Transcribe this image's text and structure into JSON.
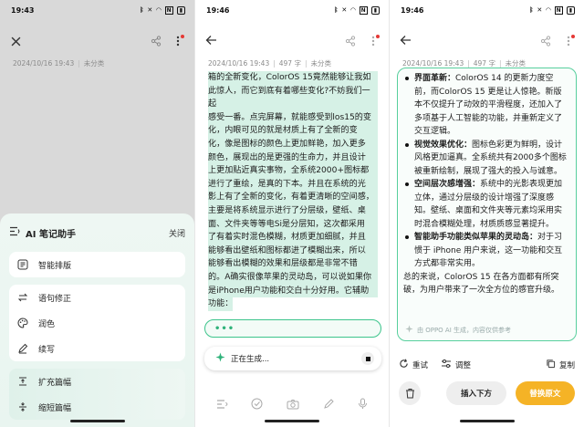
{
  "panel1": {
    "time": "19:43",
    "meta": {
      "date": "2024/10/16 19:43",
      "words": "",
      "category": "未分类"
    },
    "sheet": {
      "title": "AI 笔记助手",
      "close": "关闭",
      "items": [
        "智能排版",
        "语句修正",
        "润色",
        "续写",
        "扩充篇幅",
        "缩短篇幅"
      ]
    }
  },
  "panel2": {
    "time": "19:46",
    "meta": {
      "date": "2024/10/16 19:43",
      "words": "497 字",
      "category": "未分类"
    },
    "paragraph": [
      "箱的全新变化，ColorOS 15竟然能够让我如",
      "此惊人，而它到底有着哪些变化?不妨我们一起",
      "感受一番。点完屏幕，就能感受到los15的变",
      "化，内眼可见的就是材质上有了全新的变",
      "化，像是图标的颜色上更加鲜艳，加入更多",
      "颜色，展现出的是更强的生命力，并且设计",
      "上更加贴近真实事物，全系统2000+图标都",
      "进行了重绘，是真的下本。并且在系统的光",
      "影上有了全新的变化，有着更清晰的空间感，",
      "主要是将系统显示进行了分层级，壁纸、桌",
      "面、文件夹等等电Si是分层知，这次都采用",
      "了有着实时混色模糊，材质更加细腻，并且",
      "能够看出壁纸和图标都进了模糊出来，所以",
      "能够看出模糊的效果和层级都是非常不错",
      "的。A确实很像苹果的灵动岛，可以说如果你",
      "是iPhone用户功能和交白十分好用。它辅助",
      "功能："
    ],
    "generating": "正在生成..."
  },
  "panel3": {
    "time": "19:46",
    "meta": {
      "date": "2024/10/16 19:43",
      "words": "497 字",
      "category": "未分类"
    },
    "bullets": [
      {
        "head": "界面革新：",
        "lines": [
          "ColorOS 14 的更新力度空",
          "前，而ColorOS 15 更是让人惊艳。新版",
          "本不仅提升了动效的平滑程度，还加入了",
          "多项基于人工智能的功能，并重新定义了",
          "交互逻辑。"
        ]
      },
      {
        "head": "视觉效果优化：",
        "lines": [
          "图标色彩更为鲜明，设计",
          "风格更加逼真。全系统共有2000多个图标",
          "被重新绘制，展现了强大的投入与诚意。"
        ]
      },
      {
        "head": "空间层次感增强：",
        "lines": [
          "系统中的光影表现更加",
          "立体，通过分层级的设计增强了深度感",
          "知。壁纸、桌面和文件夹等元素均采用实",
          "时混合模糊处理，材质质感显著提升。"
        ]
      },
      {
        "head": "智能助手功能类似苹果的灵动岛：",
        "lines": [
          "对于习",
          "惯于 iPhone 用户来说，这一功能和交互",
          "方式都非常实用。"
        ]
      }
    ],
    "summary": [
      "总的来说，ColorOS 15 在各方面都有所突",
      "破，为用户带来了一次全方位的感官升级。"
    ],
    "footer": "由 OPPO AI 生成，内容仅供参考",
    "actions": {
      "retry": "重试",
      "adjust": "调整",
      "copy": "复制"
    },
    "buttons": {
      "insert": "插入下方",
      "replace": "替换原文"
    }
  },
  "colors": {
    "accent_green": "#3cc48b",
    "replace_orange": "#f5b326"
  }
}
